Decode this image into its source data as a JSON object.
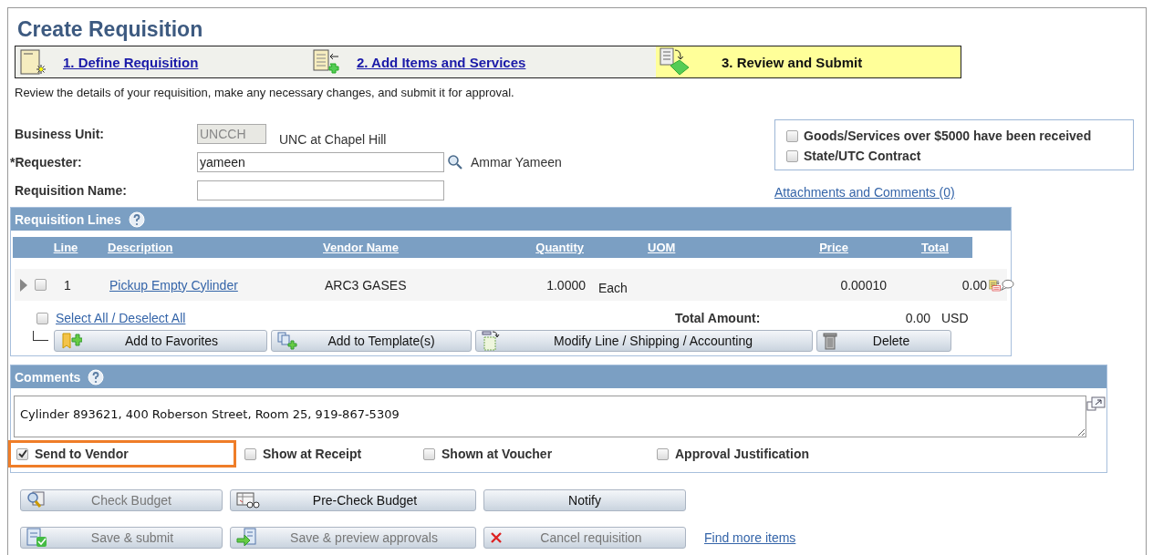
{
  "title": "Create Requisition",
  "steps": [
    {
      "label": "1. Define Requisition",
      "selected": false,
      "kind": "define"
    },
    {
      "label": "2. Add Items and Services",
      "selected": false,
      "kind": "add"
    },
    {
      "label": "3. Review and Submit",
      "selected": true,
      "kind": "review"
    }
  ],
  "intro": "Review the details of your requisition, make any necessary changes, and submit it for approval.",
  "fields": [
    {
      "label": "Business Unit:",
      "value": "UNCCH",
      "description": "UNC at Chapel Hill",
      "disabled": true,
      "kind": "code"
    },
    {
      "label": "*Requester:",
      "value": "yameen",
      "description": "Ammar Yameen",
      "disabled": false,
      "kind": "lookup"
    },
    {
      "label": "Requisition Name:",
      "disabled": false,
      "kind": "text"
    }
  ],
  "options": [
    {
      "label": "Goods/Services over $5000 have been received",
      "checked": false
    },
    {
      "label": "State/UTC Contract",
      "checked": false
    }
  ],
  "attachments_link": "Attachments and Comments (0)",
  "requisition_lines": {
    "title": "Requisition Lines",
    "columns": [
      "Line",
      "Description",
      "Vendor Name",
      "Quantity",
      "UOM",
      "Price",
      "Total"
    ],
    "rows": [
      {
        "line": "1",
        "description": "Pickup Empty Cylinder",
        "vendor": "ARC3 GASES",
        "quantity": "1.0000",
        "uom": "Each",
        "price": "0.00010",
        "total": "0.00",
        "checked": false,
        "expanded": false
      }
    ],
    "select_all": {
      "label": "Select All / Deselect All",
      "checked": false
    },
    "total_label": "Total Amount:",
    "total_amount": "0.00",
    "currency": "USD",
    "buttons": [
      {
        "label": "Add to Favorites",
        "kind": "favorites",
        "disabled": false
      },
      {
        "label": "Add to Template(s)",
        "kind": "template",
        "disabled": false
      },
      {
        "label": "Modify Line / Shipping / Accounting",
        "kind": "modify",
        "disabled": false
      },
      {
        "label": "Delete",
        "kind": "delete",
        "disabled": false
      }
    ]
  },
  "comments": {
    "title": "Comments",
    "text": "Cylinder 893621, 400 Roberson Street, Room 25, 919-867-5309",
    "checkboxes": [
      {
        "label": "Send to Vendor",
        "checked": true,
        "highlighted": true
      },
      {
        "label": "Show at Receipt",
        "checked": false,
        "highlighted": false
      },
      {
        "label": "Shown at Voucher",
        "checked": false,
        "highlighted": false
      },
      {
        "label": "Approval Justification",
        "checked": false,
        "highlighted": false
      }
    ]
  },
  "action_rows": [
    [
      {
        "label": "Check Budget",
        "kind": "check",
        "disabled": true
      },
      {
        "label": "Pre-Check Budget",
        "kind": "precheck",
        "disabled": false
      },
      {
        "label": "Notify",
        "kind": "none",
        "disabled": false
      }
    ],
    [
      {
        "label": "Save & submit",
        "kind": "submit",
        "disabled": true
      },
      {
        "label": "Save & preview approvals",
        "kind": "preview",
        "disabled": true
      },
      {
        "label": "Cancel requisition",
        "kind": "cancel",
        "disabled": true
      }
    ]
  ],
  "find_more_link": "Find more items"
}
